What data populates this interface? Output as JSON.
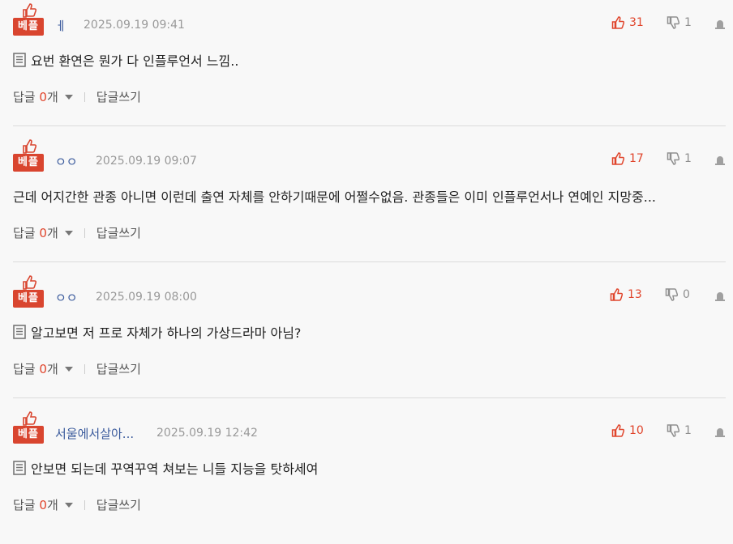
{
  "badge_label": "베플",
  "reply_label": "답글",
  "reply_unit": "개",
  "write_reply_label": "답글쓰기",
  "colors": {
    "accent": "#e0452c",
    "badge": "#d9452f",
    "nickname": "#3a5a9c"
  },
  "comments": [
    {
      "nickname": "ㅔ",
      "datetime": "2025.09.19 09:41",
      "likes": "31",
      "dislikes": "1",
      "has_doc_icon": true,
      "text": "요번 환연은 뭔가 다 인플루언서 느낌..",
      "reply_count": "0"
    },
    {
      "nickname": "ㅇㅇ",
      "datetime": "2025.09.19 09:07",
      "likes": "17",
      "dislikes": "1",
      "has_doc_icon": false,
      "text": "근데 어지간한 관종 아니면 이런데 출연 자체를 안하기때문에 어쩔수없음. 관종들은 이미 인플루언서나 연예인 지망중...",
      "reply_count": "0"
    },
    {
      "nickname": "ㅇㅇ",
      "datetime": "2025.09.19 08:00",
      "likes": "13",
      "dislikes": "0",
      "has_doc_icon": true,
      "text": "알고보면 저 프로 자체가 하나의 가상드라마 아님?",
      "reply_count": "0"
    },
    {
      "nickname": "서울에서살아...",
      "datetime": "2025.09.19 12:42",
      "likes": "10",
      "dislikes": "1",
      "has_doc_icon": true,
      "text": "안보면 되는데 꾸역꾸역 쳐보는 니들 지능을 탓하세여",
      "reply_count": "0"
    }
  ]
}
